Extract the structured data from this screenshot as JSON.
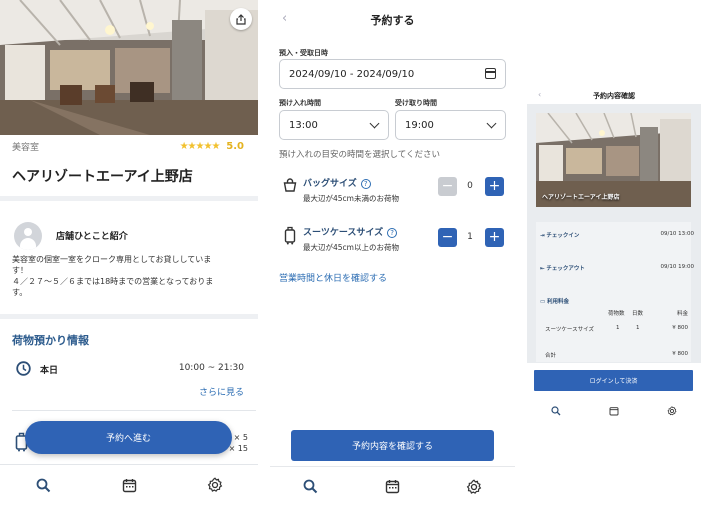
{
  "colors": {
    "primary": "#2f63b5",
    "heading": "#2c5b8d",
    "star": "#f2c12e",
    "link": "#2c6db3"
  },
  "screen1": {
    "category": "美容室",
    "stars": "★★★★★",
    "rating": "5.0",
    "shop_name": "ヘアリゾートエーアイ上野店",
    "intro_title": "店舗ひとこと紹介",
    "intro_lines": [
      "美容室の個室一室をクローク専用としてお貸ししていま",
      "す！",
      "４／２７〜５／６までは18時までの営業となっておりま",
      "す。"
    ],
    "section_title": "荷物預かり情報",
    "today_label": "本日",
    "today_hours": "10:00 ~ 21:30",
    "see_more": "さらに見る",
    "side_x1": "× 5",
    "side_x2": "× 15",
    "proceed_label": "予約へ進む",
    "share_icon": "share-icon"
  },
  "screen2": {
    "title": "予約する",
    "date_label": "預入・受取日時",
    "date_value": "2024/09/10 - 2024/09/10",
    "dropoff_label": "預け入れ時間",
    "dropoff_value": "13:00",
    "pickup_label": "受け取り時間",
    "pickup_value": "19:00",
    "hint": "預け入れの目安の時間を選択してください",
    "items": [
      {
        "name": "バッグサイズ",
        "desc": "最大辺が45cm未満のお荷物",
        "qty": "0",
        "help": "?"
      },
      {
        "name": "スーツケースサイズ",
        "desc": "最大辺が45cm以上のお荷物",
        "qty": "1",
        "help": "?"
      }
    ],
    "hours_link": "営業時間と休日を確認する",
    "confirm_label": "予約内容を確認する"
  },
  "screen3": {
    "title": "予約内容確認",
    "shop_name": "ヘアリゾートエーアイ上野店",
    "checkin_label": "チェックイン",
    "checkin_value": "09/10 13:00",
    "checkout_label": "チェックアウト",
    "checkout_value": "09/10 19:00",
    "fee_label": "利用料金",
    "col_count": "荷物数",
    "col_days": "日数",
    "col_fee": "料金",
    "row_item": "スーツケースサイズ",
    "row_count": "1",
    "row_days": "1",
    "row_fee": "¥ 800",
    "total_label": "合計",
    "total_value": "¥ 800",
    "login_label": "ログインして決済"
  }
}
